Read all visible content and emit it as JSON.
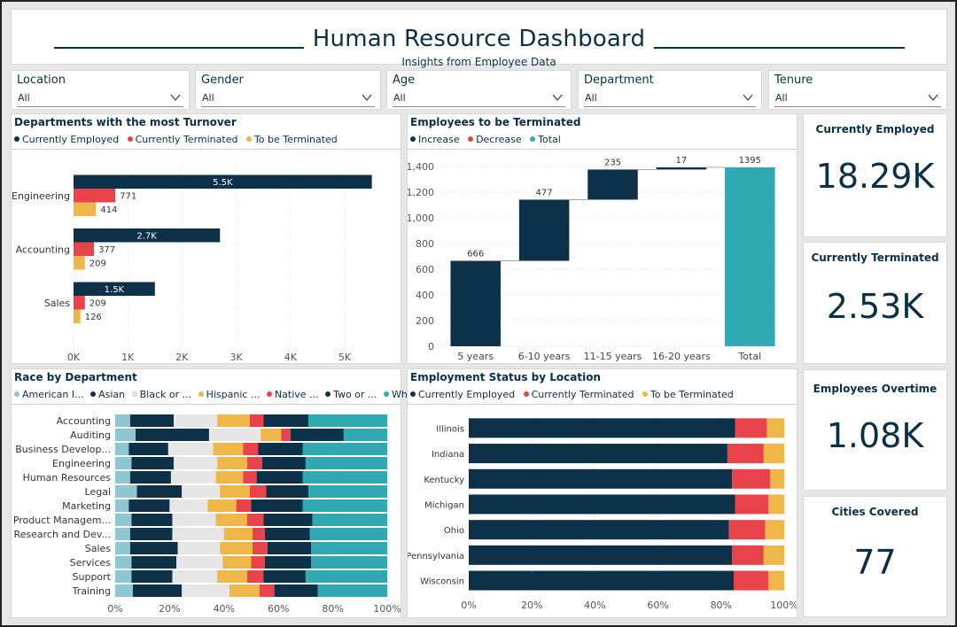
{
  "header": {
    "title": "Human Resource Dashboard",
    "subtitle": "Insights from Employee Data"
  },
  "filters": [
    {
      "label": "Location",
      "value": "All"
    },
    {
      "label": "Gender",
      "value": "All"
    },
    {
      "label": "Age",
      "value": "All"
    },
    {
      "label": "Department",
      "value": "All"
    },
    {
      "label": "Tenure",
      "value": "All"
    }
  ],
  "colors": {
    "navy": "#0d3148",
    "red": "#e8434a",
    "yellow": "#efb64a",
    "teal": "#30a9b3",
    "lightgray": "#e6e6e6",
    "lightblue": "#8ec7d2"
  },
  "kpis": [
    {
      "title": "Currently Employed",
      "value": "18.29K"
    },
    {
      "title": "Currently Terminated",
      "value": "2.53K"
    },
    {
      "title": "Employees Overtime",
      "value": "1.08K"
    },
    {
      "title": "Cities Covered",
      "value": "77"
    }
  ],
  "chart_data": [
    {
      "id": "turnover",
      "type": "bar",
      "orientation": "horizontal",
      "title": "Departments with the most Turnover",
      "categories": [
        "Engineering",
        "Accounting",
        "Sales"
      ],
      "series": [
        {
          "name": "Currently Employed",
          "values": [
            5500,
            2700,
            1500
          ],
          "labels": [
            "5.5K",
            "2.7K",
            "1.5K"
          ]
        },
        {
          "name": "Currently Terminated",
          "values": [
            771,
            377,
            209
          ],
          "labels": [
            "771",
            "377",
            "209"
          ]
        },
        {
          "name": "To be Terminated",
          "values": [
            414,
            209,
            126
          ],
          "labels": [
            "414",
            "209",
            "126"
          ]
        }
      ],
      "xlim": [
        0,
        5800
      ],
      "ticks": [
        0,
        1000,
        2000,
        3000,
        4000,
        5000
      ],
      "tick_labels": [
        "0K",
        "1K",
        "2K",
        "3K",
        "4K",
        "5K"
      ],
      "grid": true
    },
    {
      "id": "waterfall",
      "type": "bar",
      "subtype": "waterfall",
      "title": "Employees to be Terminated",
      "legend": [
        "Increase",
        "Decrease",
        "Total"
      ],
      "categories": [
        "5 years",
        "6-10 years",
        "11-15 years",
        "16-20 years",
        "Total"
      ],
      "values": [
        666,
        477,
        235,
        17,
        1395
      ],
      "labels": [
        "666",
        "477",
        "235",
        "17",
        "1395"
      ],
      "ylim": [
        0,
        1450
      ],
      "ticks": [
        0,
        200,
        400,
        600,
        800,
        1000,
        1200,
        1400
      ],
      "tick_labels": [
        "0",
        "200",
        "400",
        "600",
        "800",
        "1,000",
        "1,200",
        "1,400"
      ],
      "grid": true
    },
    {
      "id": "race",
      "type": "bar",
      "subtype": "100% stacked horizontal",
      "title": "Race by Department",
      "legend": [
        "American I...",
        "Asian",
        "Black or ...",
        "Hispanic ...",
        "Native ...",
        "Two or ...",
        "White"
      ],
      "categories": [
        "Accounting",
        "Auditing",
        "Business Develop...",
        "Engineering",
        "Human Resources",
        "Legal",
        "Marketing",
        "Product Managem...",
        "Research and Dev...",
        "Sales",
        "Services",
        "Support",
        "Training"
      ],
      "series": [
        {
          "name": "American I...",
          "values": [
            5.5,
            7.5,
            5.0,
            6.0,
            5.5,
            8.0,
            5.0,
            6.0,
            5.5,
            5.5,
            6.0,
            6.0,
            6.5
          ]
        },
        {
          "name": "Asian",
          "values": [
            16.0,
            27.0,
            14.5,
            15.5,
            15.0,
            16.5,
            15.0,
            15.0,
            15.5,
            17.5,
            16.5,
            15.0,
            18.0
          ]
        },
        {
          "name": "Black or ...",
          "values": [
            16.0,
            19.0,
            16.5,
            16.0,
            16.5,
            14.0,
            14.0,
            16.0,
            19.0,
            15.5,
            17.0,
            16.5,
            17.5
          ]
        },
        {
          "name": "Hispanic ...",
          "values": [
            12.0,
            7.5,
            11.0,
            11.0,
            10.0,
            11.0,
            10.5,
            11.5,
            10.5,
            12.0,
            10.5,
            11.0,
            11.0
          ]
        },
        {
          "name": "Native ...",
          "values": [
            5.0,
            3.5,
            5.5,
            5.5,
            5.0,
            6.0,
            5.5,
            6.0,
            4.5,
            5.5,
            5.0,
            6.0,
            5.5
          ]
        },
        {
          "name": "Two or ...",
          "values": [
            16.5,
            19.5,
            16.5,
            16.0,
            17.0,
            15.5,
            19.0,
            18.0,
            16.5,
            16.0,
            17.0,
            15.5,
            16.0
          ]
        },
        {
          "name": "White",
          "values": [
            29.0,
            16.0,
            31.0,
            30.0,
            31.0,
            29.0,
            31.0,
            27.5,
            28.5,
            28.0,
            28.0,
            30.0,
            25.5
          ]
        }
      ],
      "xlim": [
        0,
        100
      ],
      "tick_labels": [
        "0%",
        "20%",
        "40%",
        "60%",
        "80%",
        "100%"
      ]
    },
    {
      "id": "location",
      "type": "bar",
      "subtype": "100% stacked horizontal",
      "title": "Employment Status by Location",
      "categories": [
        "Illinois",
        "Indiana",
        "Kentucky",
        "Michigan",
        "Ohio",
        "Pennsylvania",
        "Wisconsin"
      ],
      "series": [
        {
          "name": "Currently Employed",
          "values": [
            84.5,
            82.0,
            83.5,
            84.5,
            82.5,
            83.5,
            84.0
          ]
        },
        {
          "name": "Currently Terminated",
          "values": [
            10.0,
            11.5,
            12.0,
            10.5,
            11.5,
            10.0,
            11.0
          ]
        },
        {
          "name": "To be Terminated",
          "values": [
            5.5,
            6.5,
            4.5,
            5.0,
            6.0,
            6.5,
            5.0
          ]
        }
      ],
      "xlim": [
        0,
        100
      ],
      "tick_labels": [
        "0%",
        "20%",
        "40%",
        "60%",
        "80%",
        "100%"
      ]
    }
  ]
}
